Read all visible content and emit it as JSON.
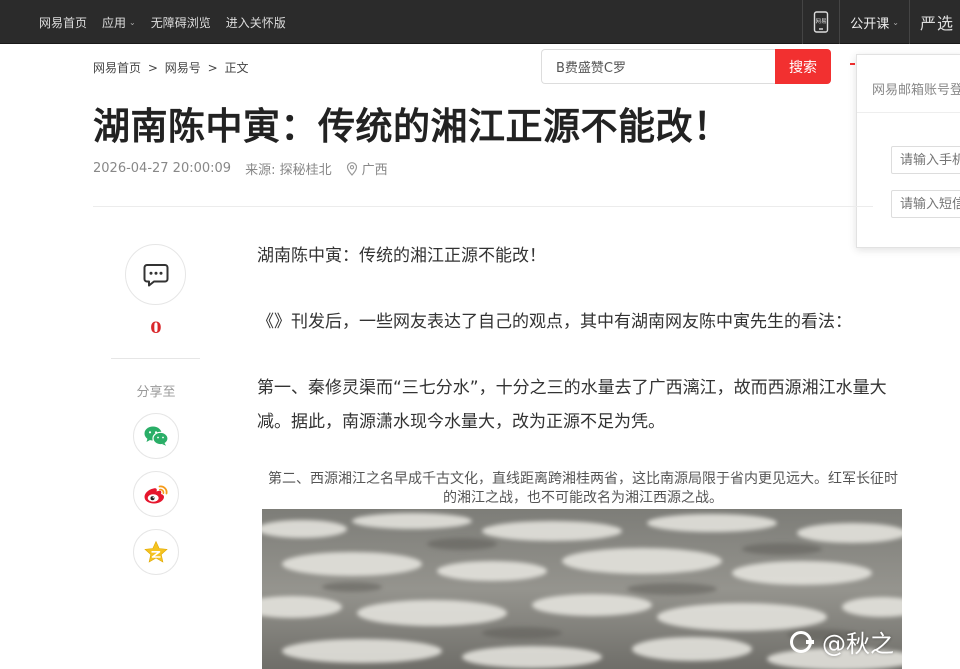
{
  "topnav": {
    "items": [
      {
        "label": "网易首页"
      },
      {
        "label": "应用",
        "has_dropdown": true
      },
      {
        "label": "无障碍浏览"
      },
      {
        "label": "进入关怀版"
      }
    ],
    "phone_label": "网易",
    "open_course": "公开课",
    "yanxuan": "严选"
  },
  "breadcrumb": [
    "网易首页",
    ">",
    "网易号",
    ">",
    "正文"
  ],
  "search": {
    "value": "B费盛赞C罗",
    "button": "搜索"
  },
  "login": {
    "title": "网易邮箱账号登",
    "phone_placeholder": "请输入手机",
    "code_placeholder": "请输入短信"
  },
  "article": {
    "title": "湖南陈中寅：传统的湘江正源不能改！",
    "datetime": "2026-04-27 20:00:09",
    "source": "来源: 探秘桂北",
    "location": "广西",
    "paragraphs": [
      "湖南陈中寅：传统的湘江正源不能改！",
      "《》刊发后，一些网友表达了自己的观点，其中有湖南网友陈中寅先生的看法：",
      "第一、秦修灵渠而“三七分水”，十分之三的水量去了广西漓江，故而西源湘江水量大减。据此，南源潇水现今水量大，改为正源不足为凭。"
    ],
    "caption": "第二、西源湘江之名早成千古文化，直线距离跨湘桂两省，这比南源局限于省内更见远大。红军长征时的湘江之战，也不可能改名为湘江西源之战。",
    "watermark": "@秋之"
  },
  "sidebar": {
    "comment_count": "0",
    "share_label": "分享至"
  },
  "colors": {
    "topbar": "#2b2b2b",
    "accent_red": "#f23030",
    "comment_red": "#d9262a",
    "wechat_green": "#2aae67",
    "weibo_red": "#e6162d",
    "qzone_yellow": "#f5c320"
  }
}
